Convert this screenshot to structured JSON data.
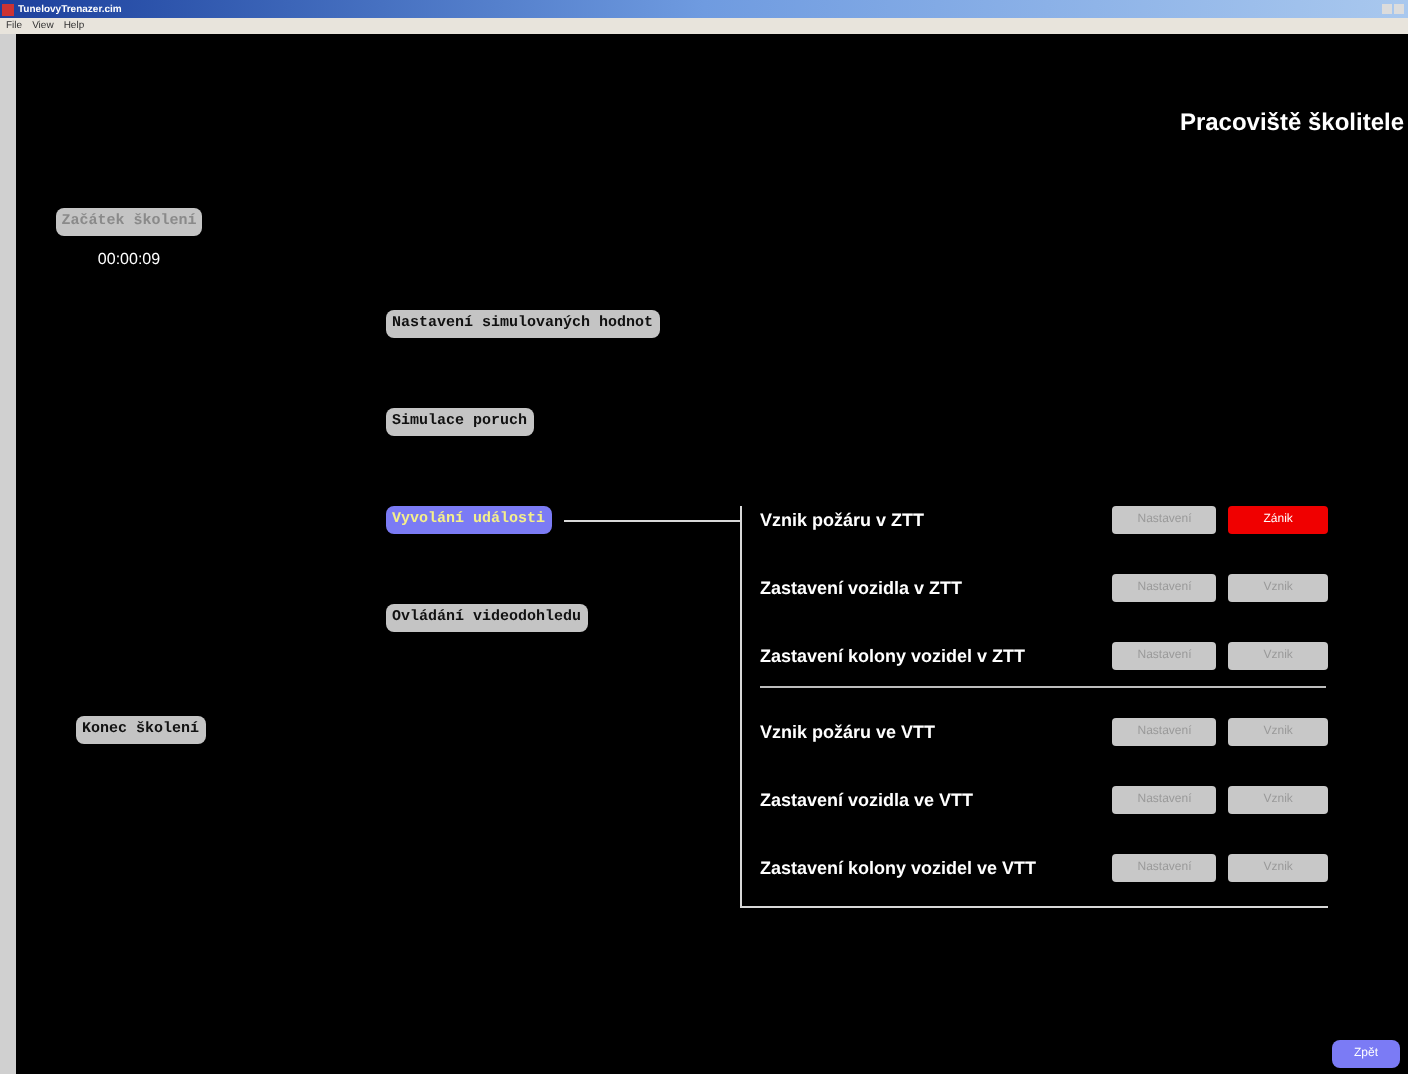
{
  "window": {
    "title": "TunelovyTrenazer.cim"
  },
  "menu": [
    "File",
    "View",
    "Help"
  ],
  "heading": "Pracoviště školitele",
  "session": {
    "start_button": {
      "label": "Začátek školení",
      "disabled": true
    },
    "time": "00:00:09",
    "end_button": {
      "label": "Konec školení",
      "disabled": false
    }
  },
  "sections": [
    {
      "label": "Nastavení simulovaných hodnot",
      "selected": false
    },
    {
      "label": "Simulace poruch",
      "selected": false
    },
    {
      "label": "Vyvolání události",
      "selected": true
    },
    {
      "label": "Ovládání videodohledu",
      "selected": false
    }
  ],
  "event_groups": [
    {
      "rows": [
        {
          "label": "Vznik požáru v ZTT",
          "settings": {
            "label": "Nastavení",
            "disabled": true
          },
          "action": {
            "label": "Zánik",
            "active": true
          }
        },
        {
          "label": "Zastavení vozidla v ZTT",
          "settings": {
            "label": "Nastavení",
            "disabled": true
          },
          "action": {
            "label": "Vznik",
            "active": false
          }
        },
        {
          "label": "Zastavení kolony vozidel v ZTT",
          "settings": {
            "label": "Nastavení",
            "disabled": true
          },
          "action": {
            "label": "Vznik",
            "active": false
          }
        }
      ]
    },
    {
      "rows": [
        {
          "label": "Vznik požáru ve VTT",
          "settings": {
            "label": "Nastavení",
            "disabled": true
          },
          "action": {
            "label": "Vznik",
            "active": false
          }
        },
        {
          "label": "Zastavení vozidla ve VTT",
          "settings": {
            "label": "Nastavení",
            "disabled": true
          },
          "action": {
            "label": "Vznik",
            "active": false
          }
        },
        {
          "label": "Zastavení kolony vozidel ve VTT",
          "settings": {
            "label": "Nastavení",
            "disabled": true
          },
          "action": {
            "label": "Vznik",
            "active": false
          }
        }
      ]
    }
  ],
  "back_button": "Zpět"
}
